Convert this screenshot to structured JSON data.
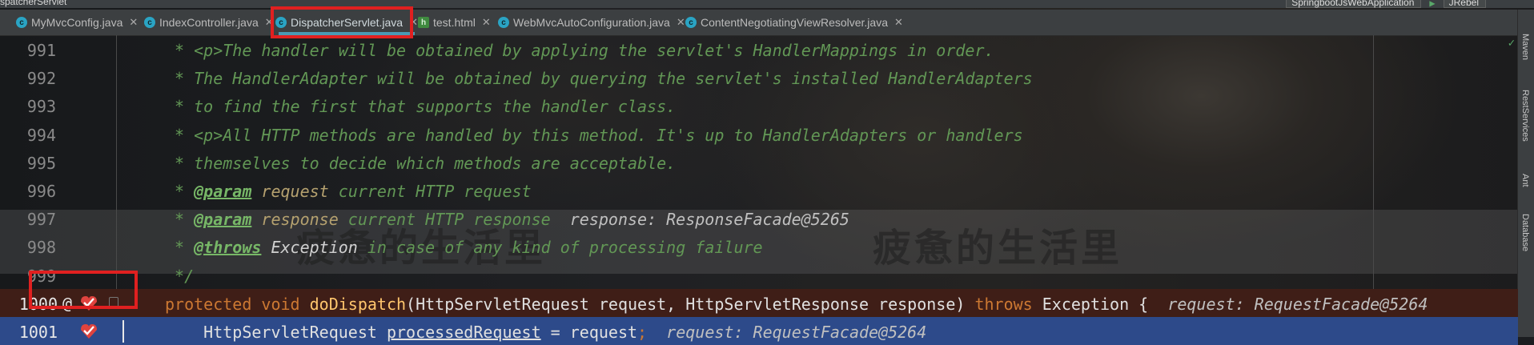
{
  "window": {
    "title": "spatcherServlet",
    "run_config": "SpringbootJsWebApplication",
    "jrebel_label": "JRebel"
  },
  "tabs": [
    {
      "label": "MyMvcConfig.java",
      "icon": "class-icon",
      "active": false
    },
    {
      "label": "IndexController.java",
      "icon": "class-icon",
      "active": false
    },
    {
      "label": "DispatcherServlet.java",
      "icon": "class-icon",
      "active": true
    },
    {
      "label": "test.html",
      "icon": "html-file-icon",
      "active": false
    },
    {
      "label": "WebMvcAutoConfiguration.java",
      "icon": "class-icon",
      "active": false
    },
    {
      "label": "ContentNegotiatingViewResolver.java",
      "icon": "class-icon",
      "active": false
    }
  ],
  "right_tool_windows": [
    "Maven",
    "RestServices",
    "Ant",
    "Database"
  ],
  "editor": {
    "lines": [
      {
        "num": "991",
        "text": " * <p>The handler will be obtained by applying the servlet's HandlerMappings in order."
      },
      {
        "num": "992",
        "text": " * The HandlerAdapter will be obtained by querying the servlet's installed HandlerAdapters"
      },
      {
        "num": "993",
        "text": " * to find the first that supports the handler class."
      },
      {
        "num": "994",
        "text": " * <p>All HTTP methods are handled by this method. It's up to HandlerAdapters or handlers"
      },
      {
        "num": "995",
        "text": " * themselves to decide which methods are acceptable."
      },
      {
        "num": "996",
        "prefix": " * ",
        "tag": "@param",
        "param": " request",
        "rest": " current HTTP request",
        "hint": ""
      },
      {
        "num": "997",
        "prefix": " * ",
        "tag": "@param",
        "param": " response",
        "rest": " current HTTP response  ",
        "hint": "response: ResponseFacade@5265"
      },
      {
        "num": "998",
        "prefix": " * ",
        "tag": "@throws",
        "exception": " Exception",
        "rest": " in case of any kind of processing failure"
      },
      {
        "num": "999",
        "text": " */"
      },
      {
        "num": "1000",
        "kw1": "protected void ",
        "fn": "doDispatch",
        "p1": "(HttpServletRequest request, HttpServletResponse response) ",
        "kw2": "throws ",
        "p2": "Exception {  ",
        "hint": "request: RequestFacade@5264"
      },
      {
        "num": "1001",
        "p1": "    HttpServletRequest ",
        "var": "processedRequest",
        "p2": " = request",
        "semi": ";",
        "hint": "  request: RequestFacade@5264"
      }
    ]
  },
  "watermark": {
    "text": "疲惫的生活里"
  }
}
